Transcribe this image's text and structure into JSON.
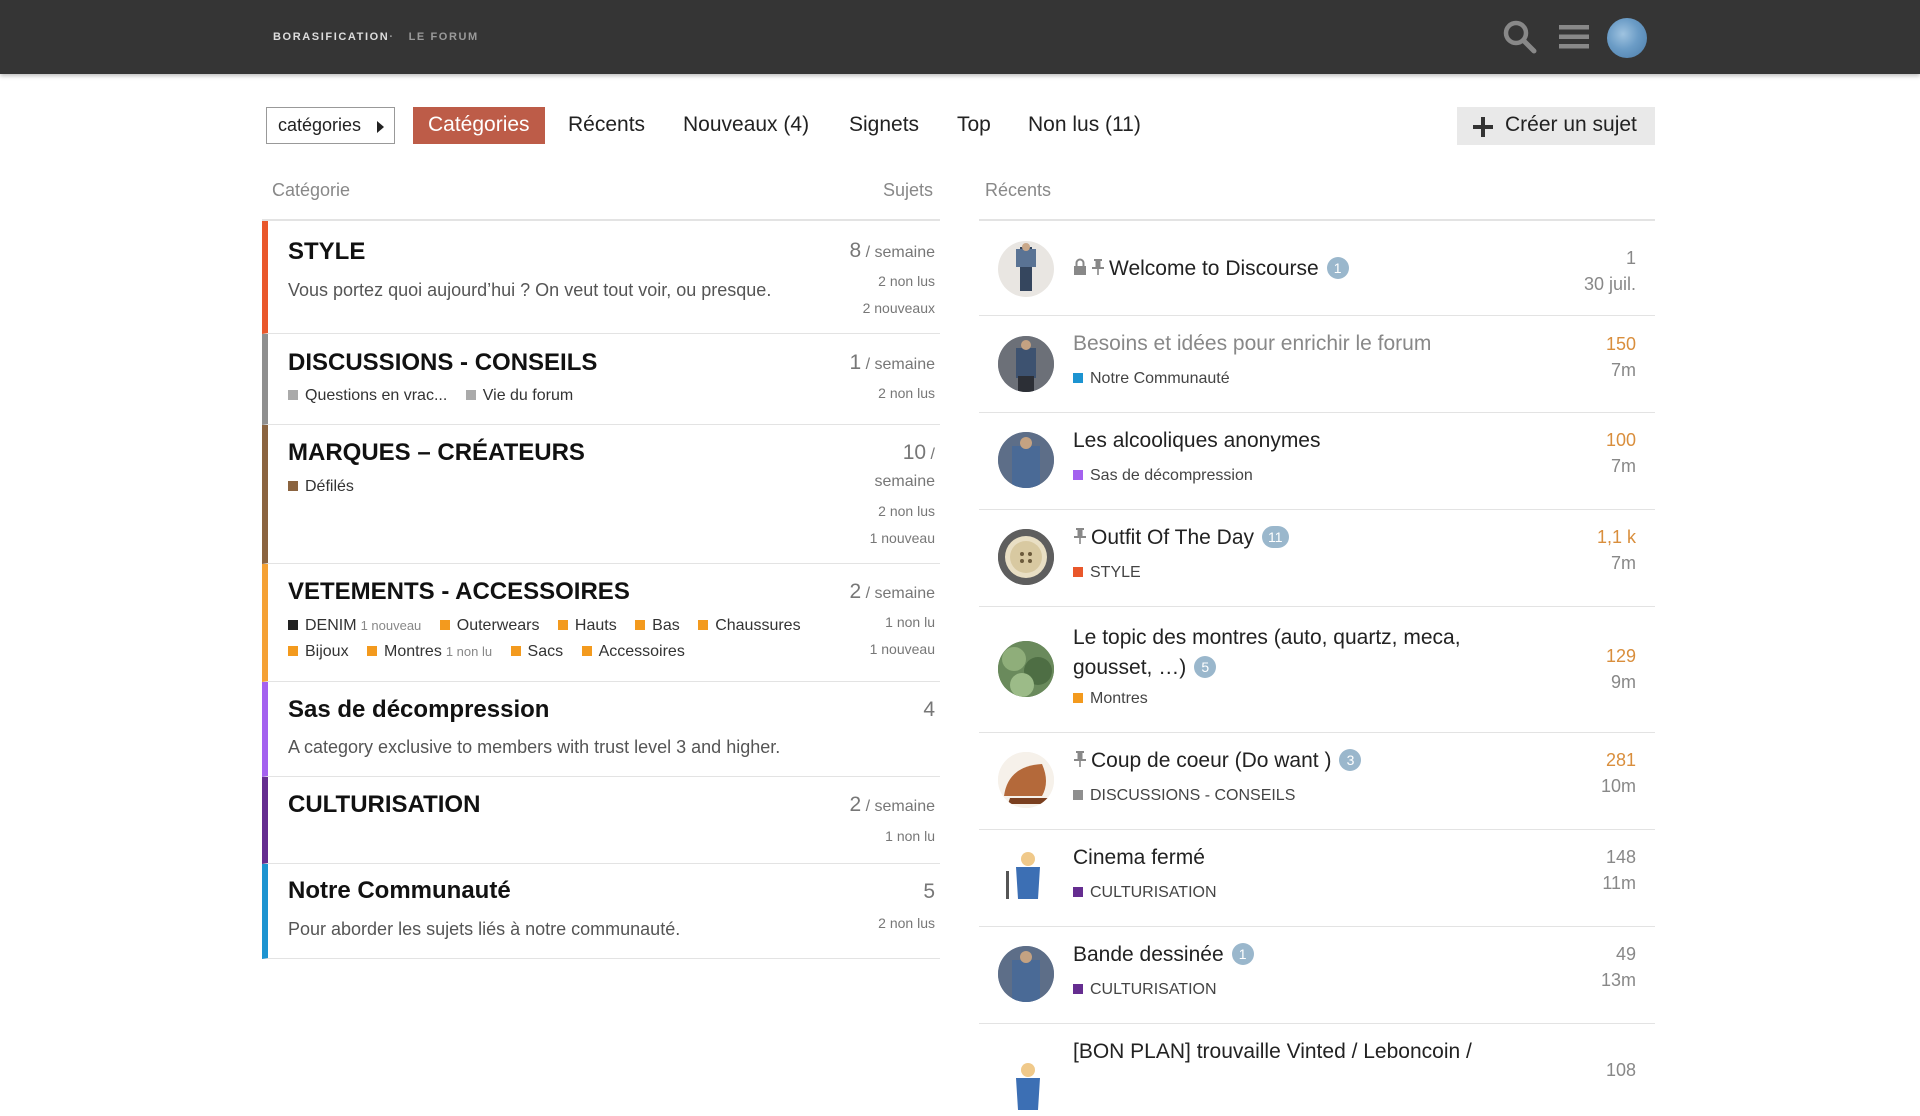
{
  "header": {
    "logo_main": "BORASIFICATION",
    "logo_sep": " · ",
    "logo_sub": "LE FORUM",
    "search_icon": "search-icon",
    "menu_icon": "hamburger-icon",
    "user_icon": "user-avatar"
  },
  "nav": {
    "category_dropdown": "catégories",
    "tabs": [
      "Catégories",
      "Récents",
      "Nouveaux (4)",
      "Signets",
      "Top",
      "Non lus (11)"
    ],
    "active_tab": "Catégories",
    "create_topic": "Créer un sujet",
    "accent_color": "#bd5c48"
  },
  "categories_table": {
    "col_category": "Catégorie",
    "col_topics": "Sujets",
    "rows": [
      {
        "name": "STYLE",
        "color": "#e9572b",
        "description": "Vous portez quoi aujourd’hui ? On veut tout voir, ou presque.",
        "count": "8",
        "unit": " / semaine",
        "stat1": "2 non lus",
        "stat2": "2 nouveaux"
      },
      {
        "name": "DISCUSSIONS - CONSEILS",
        "color": "#8f8f8f",
        "subcats": [
          {
            "name": "Questions en vrac...",
            "color": "#aaaaaa"
          },
          {
            "name": "Vie du forum",
            "color": "#aaaaaa"
          }
        ],
        "count": "1",
        "unit": " / semaine",
        "stat1": "2 non lus"
      },
      {
        "name": "MARQUES – CRÉATEURS",
        "color": "#8b6440",
        "subcats": [
          {
            "name": "Défilés",
            "color": "#8b6440"
          }
        ],
        "count": "10",
        "unit_line1": " /",
        "unit_line2": "semaine",
        "stat1": "2 non lus",
        "stat2": "1 nouveau"
      },
      {
        "name": "VETEMENTS - ACCESSOIRES",
        "color": "#f5a134",
        "subcats_line1": [
          {
            "name": "DENIM",
            "color": "#222222",
            "note": "1 nouveau"
          },
          {
            "name": "Outerwears",
            "color": "#f39a1e"
          },
          {
            "name": "Hauts",
            "color": "#f39a1e"
          },
          {
            "name": "Bas",
            "color": "#f39a1e"
          },
          {
            "name": "Chaussures",
            "color": "#f39a1e"
          }
        ],
        "subcats_line2": [
          {
            "name": "Bijoux",
            "color": "#f39a1e"
          },
          {
            "name": "Montres",
            "color": "#f39a1e",
            "note": "1 non lu"
          },
          {
            "name": "Sacs",
            "color": "#f39a1e"
          },
          {
            "name": "Accessoires",
            "color": "#f39a1e"
          }
        ],
        "count": "2",
        "unit": " / semaine",
        "stat1": "1 non lu",
        "stat2": "1 nouveau"
      },
      {
        "name": "Sas de décompression",
        "color": "#a461ef",
        "description": "A category exclusive to members with trust level 3 and higher.",
        "count": "4"
      },
      {
        "name": "CULTURISATION",
        "color": "#652d90",
        "count": "2",
        "unit": " / semaine",
        "stat1": "1 non lu"
      },
      {
        "name": "Notre Communauté",
        "color": "#1d94d1",
        "description": "Pour aborder les sujets liés à notre communauté.",
        "count": "5",
        "stat1": "2 non lus"
      }
    ]
  },
  "topics_table": {
    "col_recent": "Récents",
    "rows": [
      {
        "title": "Welcome to Discourse",
        "locked": true,
        "pinned": true,
        "badge": "1",
        "replies": "1",
        "activity": "30 juil."
      },
      {
        "title": "Besoins et idées pour enrichir le forum",
        "read": true,
        "category": "Notre Communauté",
        "cat_color": "#1d94d1",
        "replies": "150",
        "hot": true,
        "activity": "7m"
      },
      {
        "title": "Les alcooliques anonymes",
        "category": "Sas de décompression",
        "cat_color": "#a461ef",
        "replies": "100",
        "hot": true,
        "activity": "7m"
      },
      {
        "title": "Outfit Of The Day",
        "pinned": true,
        "badge": "11",
        "category": "STYLE",
        "cat_color": "#e9572b",
        "replies": "1,1 k",
        "hot": true,
        "activity": "7m"
      },
      {
        "title": "Le topic des montres (auto, quartz, meca, gousset, …)",
        "badge": "5",
        "category": "Montres",
        "cat_color": "#f39a1e",
        "replies": "129",
        "hot": true,
        "activity": "9m"
      },
      {
        "title": "Coup de coeur (Do want )",
        "pinned": true,
        "badge": "3",
        "category": "DISCUSSIONS - CONSEILS",
        "cat_color": "#8f8f8f",
        "replies": "281",
        "hot": true,
        "activity": "10m"
      },
      {
        "title": "Cinema fermé",
        "category": "CULTURISATION",
        "cat_color": "#652d90",
        "replies": "148",
        "activity": "11m"
      },
      {
        "title": "Bande dessinée",
        "badge": "1",
        "category": "CULTURISATION",
        "cat_color": "#652d90",
        "replies": "49",
        "activity": "13m"
      },
      {
        "title": "[BON PLAN] trouvaille Vinted / Leboncoin /",
        "replies": "108"
      }
    ]
  }
}
